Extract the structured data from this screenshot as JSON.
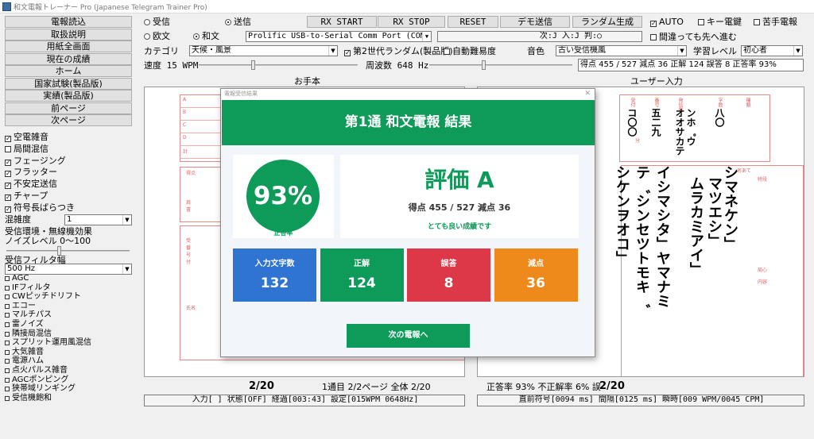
{
  "window": {
    "title": "和文電報トレーナー Pro (Japanese Telegram Trainer Pro)"
  },
  "nav_buttons": [
    "電報読込",
    "取扱説明",
    "用紙全画面",
    "現在の成績",
    "ホーム",
    "国家試験(製品版)",
    "実績(製品版)",
    "前ページ",
    "次ページ"
  ],
  "options_checks": [
    {
      "label": "空電雑音",
      "checked": true
    },
    {
      "label": "局間混信",
      "checked": false
    },
    {
      "label": "フェージング",
      "checked": true
    },
    {
      "label": "フラッター",
      "checked": true
    },
    {
      "label": "不安定送信",
      "checked": true
    },
    {
      "label": "チャープ",
      "checked": true
    },
    {
      "label": "符号長ばらつき",
      "checked": true
    }
  ],
  "noise_label": "混雑度",
  "noise_value": "1",
  "env_label": "受信環境・無線機効果",
  "noise_level_label": "ノイズレベル 0〜100",
  "filter_label": "受信フィルタ幅",
  "filter_value": "500 Hz",
  "effects": [
    "AGC",
    "IFフィルタ",
    "CWピッチドリフト",
    "エコー",
    "マルチパス",
    "雷ノイズ",
    "隣接局混信",
    "スプリット運用風混信",
    "大気雑音",
    "電源ハム",
    "点火パルス雑音",
    "AGCポンピング",
    "狭帯域リンギング",
    "受信機飽和"
  ],
  "top": {
    "rx_label": "受信",
    "tx_label": "送信",
    "oubun_label": "欧文",
    "wabun_label": "和文",
    "rx_start": "RX START",
    "rx_stop": "RX STOP",
    "reset": "RESET",
    "demo": "デモ送信",
    "random": "ランダム生成",
    "auto": "AUTO",
    "key_label": "キー電鍵",
    "weak_label": "苦手電報",
    "port": "Prolific USB-to-Serial Comm Port (COM4)",
    "next_info": "次:J  入:J  判:○",
    "continue_label": "間違っても先へ進む",
    "category_label": "カテゴリ",
    "category_value": "天候・風景",
    "gen2_label": "第2世代ランダム(製品版)",
    "auto_diff_label": "自動難易度",
    "tone_label": "音色",
    "tone_value": "古い受信機風",
    "level_label": "学習レベル",
    "level_value": "初心者",
    "speed_label": "速度 15 WPM",
    "freq_label": "周波数 648 Hz",
    "score_line": "得点 455 / 527  減点 36  正解 124  誤答 8  正答率 93%"
  },
  "panels": {
    "model_label": "お手本",
    "user_label": "ユーザー入力"
  },
  "form_left": {
    "row_labels": [
      "A",
      "B",
      "C",
      "D",
      "計"
    ],
    "block_labels": [
      "得点",
      "肩\n書",
      "受\n番\n号\n付",
      "氏名"
    ]
  },
  "form_right": {
    "headers": [
      "受付",
      "番号",
      "発信局",
      "字数",
      "種類"
    ],
    "header_values": [
      "コ〇〇",
      "五二九",
      "オオサカテ",
      "八〇"
    ],
    "small": "分",
    "station_extra": "ンホ゜ウ",
    "right_labels": [
      "名あて",
      "特段",
      "局心",
      "内容"
    ],
    "columns": [
      "シマネケン」",
      "マツエシ」",
      "ムラカミアイ」",
      "イシマシタ」ヤマナミ",
      "テ゛シンセツトモキ゛",
      "シケンヲオコ」"
    ]
  },
  "dialog": {
    "title": "電報受信結果",
    "header": "第1通 和文電報 結果",
    "percent": "93%",
    "percent_label": "正答率",
    "grade": "評価 A",
    "score_text": "得点 455 / 527  減点 36",
    "comment": "とても良い成績です",
    "stats": [
      {
        "label": "入力文字数",
        "value": "132",
        "color": "#2f74d0"
      },
      {
        "label": "正解",
        "value": "124",
        "color": "#0e9a59"
      },
      {
        "label": "誤答",
        "value": "8",
        "color": "#dc3848"
      },
      {
        "label": "減点",
        "value": "36",
        "color": "#ee8a1c"
      }
    ],
    "next_button": "次の電報へ"
  },
  "bottom": {
    "left_count": "2/20",
    "page_info": "1通目 2/2ページ  全体 2/20",
    "right_stats": "正答率 93%  不正解率 6%  誤",
    "right_count": "2/20",
    "status_left": "入力[   ]  状態[OFF] 経過[003:43] 設定[015WPM 0648Hz]",
    "status_right": "直前符号[0094 ms] 間隔[0125 ms] 瞬時[009 WPM/0045 CPM]"
  }
}
